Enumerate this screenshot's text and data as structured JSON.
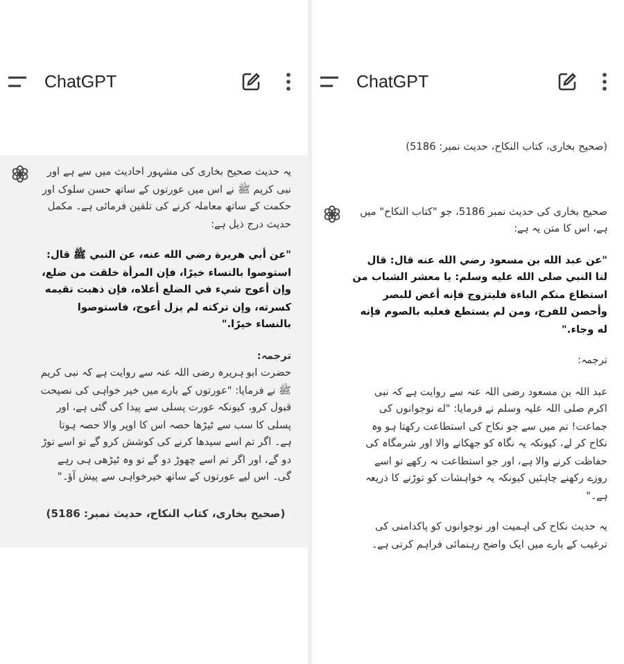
{
  "screens": [
    {
      "title": "ChatGPT",
      "messages": [
        {
          "kind": "user",
          "paragraphs": [
            {
              "kind": "normal",
              "text": "(صحیح بخاری، کتاب النکاح، حدیث نمبر: 5186)"
            }
          ]
        },
        {
          "kind": "assistant",
          "highlighted": false,
          "paragraphs": [
            {
              "kind": "normal",
              "text": "صحیح بخاری کی حدیث نمبر 5186، جو \"کتاب النکاح\" میں ہے، اس کا متن یہ ہے:"
            },
            {
              "kind": "bold",
              "text": "\"عن عبد الله بن مسعود رضي الله عنه قال: قال لنا النبي صلى الله عليه وسلم: يا معشر الشباب من استطاع منكم الباءة فليتزوج فإنه أغض للبصر وأحصن للفرج، ومن لم يستطع فعليه بالصوم فإنه له وجاء.\""
            },
            {
              "kind": "normal",
              "text": "ترجمہ:"
            },
            {
              "kind": "normal",
              "text": "عبد اللہ بن مسعود رضی اللہ عنہ سے روایت ہے کہ نبی اکرم صلی اللہ علیہ وسلم نے فرمایا: \"اے نوجوانوں کی جماعت! تم میں سے جو نکاح کی استطاعت رکھتا ہو وہ نکاح کر لے، کیونکہ یہ نگاہ کو جھکانے والا اور شرمگاہ کی حفاظت کرنے والا ہے، اور جو استطاعت نہ رکھے تو اسے روزے رکھنے چاہئیں کیونکہ یہ خواہشات کو توڑنے کا ذریعہ ہے۔\""
            },
            {
              "kind": "normal",
              "text": "یہ حدیث نکاح کی اہمیت اور نوجوانوں کو پاکدامنی کی ترغیب کے بارے میں ایک واضح رہنمائی فراہم کرتی ہے۔"
            }
          ]
        }
      ]
    },
    {
      "title": "ChatGPT",
      "messages": [
        {
          "kind": "assistant",
          "highlighted": true,
          "paragraphs": [
            {
              "kind": "normal",
              "text": "یہ حدیث صحیح بخاری کی مشہور احادیث میں سے ہے اور نبی کریم ﷺ نے اس میں عورتوں کے ساتھ حسن سلوک اور حکمت کے ساتھ معاملہ کرنے کی تلقین فرمائی ہے۔ مکمل حدیث درج ذیل ہے:"
            },
            {
              "kind": "bold",
              "text": "\"عن أبي هريرة رضي الله عنه، عن النبي ﷺ قال: استوصوا بالنساء خيرًا، فإن المرأة خلقت من ضلع، وإن أعوج شيء في الضلع أعلاه، فإن ذهبت تقيمه كسرته، وإن تركته لم يزل أعوج، فاستوصوا بالنساء خيرًا.\""
            },
            {
              "kind": "heading",
              "text": "ترجمہ:"
            },
            {
              "kind": "normal",
              "text": "حضرت ابو ہریرہ رضی اللہ عنہ سے روایت ہے کہ نبی کریم ﷺ نے فرمایا: \"عورتوں کے بارے میں خیر خواہی کی نصیحت قبول کرو، کیونکہ عورت پسلی سے پیدا کی گئی ہے، اور پسلی کا سب سے ٹیڑھا حصہ اس کا اوپر والا حصہ ہوتا ہے۔ اگر تم اسے سیدھا کرنے کی کوشش کرو گے تو اسے توڑ دو گے، اور اگر تم اسے چھوڑ دو گے تو وہ ٹیڑھی ہی رہے گی۔ اس لیے عورتوں کے ساتھ خیرخواہی سے پیش آؤ۔\""
            },
            {
              "kind": "source",
              "text": "(صحیح بخاری، کتاب النکاح، حدیث نمبر: 5186)"
            }
          ]
        }
      ]
    }
  ]
}
